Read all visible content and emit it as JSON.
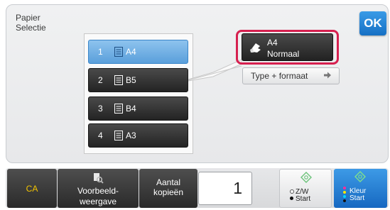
{
  "header": {
    "title_line1": "Papier",
    "title_line2": "Selectie",
    "ok_label": "OK"
  },
  "trays": [
    {
      "number": "1",
      "size": "A4",
      "selected": true
    },
    {
      "number": "2",
      "size": "B5",
      "selected": false
    },
    {
      "number": "3",
      "size": "B4",
      "selected": false
    },
    {
      "number": "4",
      "size": "A3",
      "selected": false
    }
  ],
  "selected_paper": {
    "size": "A4",
    "type": "Normaal"
  },
  "type_format_label": "Type + formaat",
  "footer": {
    "ca_label": "CA",
    "preview_line1": "Voorbeeld-",
    "preview_line2": "weergave",
    "copies_label_line1": "Aantal",
    "copies_label_line2": "kopieën",
    "copies_value": "1",
    "bw_line1": "Z/W",
    "bw_line2": "Start",
    "color_line1": "Kleur",
    "color_line2": "Start"
  },
  "icons": {
    "tray": "paper-tray-icon",
    "hand": "hand-paper-icon",
    "arrow": "arrow-right-icon",
    "preview": "preview-magnifier-icon",
    "start": "start-diamond-icon"
  },
  "colors": {
    "accent_blue": "#2a86d6",
    "highlight_red": "#d6204f",
    "ca_yellow": "#f3c400",
    "dark_button": "#2a2a2a",
    "start_green": "#6cc37a"
  }
}
